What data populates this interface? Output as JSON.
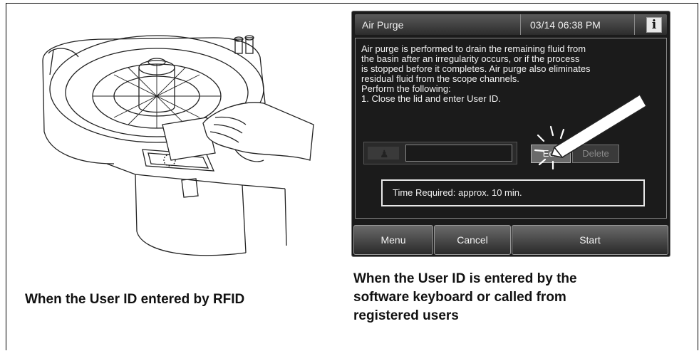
{
  "screen": {
    "title": "Air Purge",
    "datetime": "03/14 06:38 PM",
    "info_icon_glyph": "i",
    "message_lines": [
      "Air purge is performed to drain the remaining fluid from",
      "the basin after an irregularity occurs, or if the process",
      "is stopped before it completes. Air purge also eliminates",
      "residual fluid from the scope channels.",
      "Perform the following:",
      "1. Close the lid and enter User ID."
    ],
    "edit_label": "Edit",
    "delete_label": "Delete",
    "time_required": "Time Required: approx. 10 min.",
    "buttons": {
      "menu": "Menu",
      "cancel": "Cancel",
      "start": "Start"
    }
  },
  "captions": {
    "left": "When the User ID entered by RFID",
    "right_lines": [
      "When the User ID is entered by the",
      "software keyboard or called from",
      "registered users"
    ]
  },
  "icons": {
    "user": "user-icon",
    "info": "info-icon",
    "stylus": "stylus-icon",
    "rfid_card": "rfid-card-icon"
  },
  "colors": {
    "screen_bg": "#1b1b1b",
    "text": "#f2f2f2",
    "caption": "#111111"
  }
}
